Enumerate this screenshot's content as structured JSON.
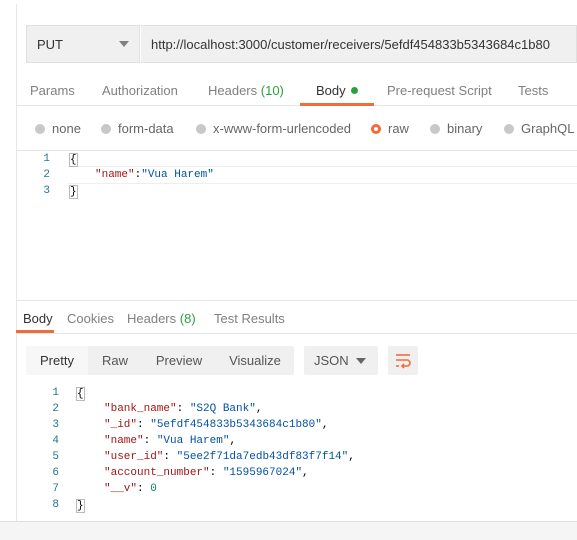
{
  "request": {
    "method": "PUT",
    "url": "http://localhost:3000/customer/receivers/5efdf454833b5343684c1b80"
  },
  "request_tabs": {
    "params": "Params",
    "authorization": "Authorization",
    "headers": "Headers",
    "headers_count": "(10)",
    "body": "Body",
    "pre_request": "Pre-request Script",
    "tests": "Tests"
  },
  "body_types": {
    "none": "none",
    "form_data": "form-data",
    "urlencoded": "x-www-form-urlencoded",
    "raw": "raw",
    "binary": "binary",
    "graphql": "GraphQL",
    "selected": "raw"
  },
  "request_body": {
    "line_numbers": [
      "1",
      "2",
      "3"
    ],
    "open": "{",
    "key": "\"name\"",
    "colon": ":",
    "value": "\"Vua Harem\"",
    "close": "}"
  },
  "response_tabs": {
    "body": "Body",
    "cookies": "Cookies",
    "headers": "Headers",
    "headers_count": "(8)",
    "test_results": "Test Results"
  },
  "response_toolbar": {
    "pretty": "Pretty",
    "raw": "Raw",
    "preview": "Preview",
    "visualize": "Visualize",
    "format": "JSON",
    "wrap_icon": "wrap-lines-icon"
  },
  "response_body": {
    "line_numbers": [
      "1",
      "2",
      "3",
      "4",
      "5",
      "6",
      "7",
      "8"
    ],
    "open": "{",
    "close": "}",
    "fields": [
      {
        "key": "\"bank_name\"",
        "value": "\"S2Q Bank\"",
        "comma": ","
      },
      {
        "key": "\"_id\"",
        "value": "\"5efdf454833b5343684c1b80\"",
        "comma": ","
      },
      {
        "key": "\"name\"",
        "value": "\"Vua Harem\"",
        "comma": ","
      },
      {
        "key": "\"user_id\"",
        "value": "\"5ee2f71da7edb43df83f7f14\"",
        "comma": ","
      },
      {
        "key": "\"account_number\"",
        "value": "\"1595967024\"",
        "comma": ","
      },
      {
        "key": "\"__v\"",
        "value": "0",
        "comma": ""
      }
    ]
  },
  "colors": {
    "accent": "#f26b3a",
    "count_green": "#26a33b",
    "json_key": "#a31515",
    "json_string": "#0451a5",
    "json_number": "#098658"
  }
}
